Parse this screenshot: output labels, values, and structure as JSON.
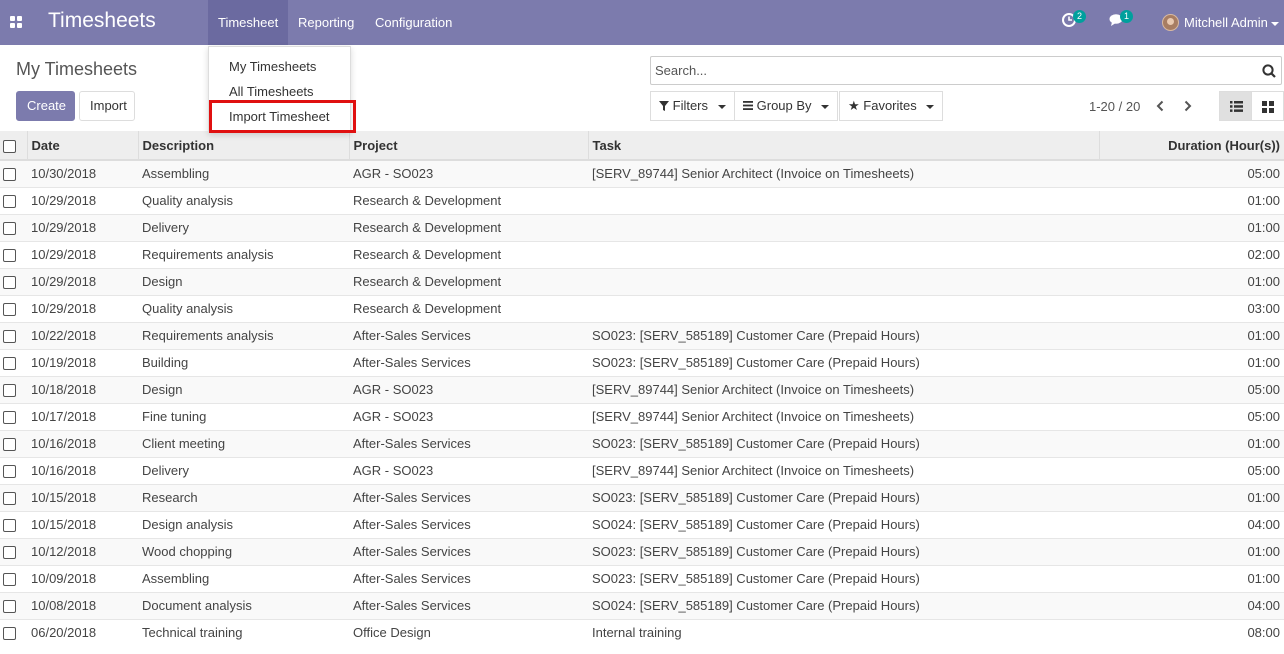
{
  "navbar": {
    "app_title": "Timesheets",
    "menu": [
      "Timesheet",
      "Reporting",
      "Configuration"
    ],
    "activity_badge": "2",
    "messages_badge": "1",
    "user_name": "Mitchell Admin"
  },
  "dropdown": {
    "items": [
      "My Timesheets",
      "All Timesheets",
      "Import Timesheet"
    ],
    "highlighted": "Import Timesheet"
  },
  "control_panel": {
    "title": "My Timesheets",
    "create_label": "Create",
    "import_label": "Import",
    "search_placeholder": "Search...",
    "filters_label": "Filters",
    "group_by_label": "Group By",
    "favorites_label": "Favorites",
    "pager": "1-20 / 20"
  },
  "table": {
    "columns": [
      "Date",
      "Description",
      "Project",
      "Task",
      "Duration (Hour(s))"
    ],
    "rows": [
      [
        "10/30/2018",
        "Assembling",
        "AGR - SO023",
        "[SERV_89744] Senior Architect (Invoice on Timesheets)",
        "05:00"
      ],
      [
        "10/29/2018",
        "Quality analysis",
        "Research & Development",
        "",
        "01:00"
      ],
      [
        "10/29/2018",
        "Delivery",
        "Research & Development",
        "",
        "01:00"
      ],
      [
        "10/29/2018",
        "Requirements analysis",
        "Research & Development",
        "",
        "02:00"
      ],
      [
        "10/29/2018",
        "Design",
        "Research & Development",
        "",
        "01:00"
      ],
      [
        "10/29/2018",
        "Quality analysis",
        "Research & Development",
        "",
        "03:00"
      ],
      [
        "10/22/2018",
        "Requirements analysis",
        "After-Sales Services",
        "SO023: [SERV_585189] Customer Care (Prepaid Hours)",
        "01:00"
      ],
      [
        "10/19/2018",
        "Building",
        "After-Sales Services",
        "SO023: [SERV_585189] Customer Care (Prepaid Hours)",
        "01:00"
      ],
      [
        "10/18/2018",
        "Design",
        "AGR - SO023",
        "[SERV_89744] Senior Architect (Invoice on Timesheets)",
        "05:00"
      ],
      [
        "10/17/2018",
        "Fine tuning",
        "AGR - SO023",
        "[SERV_89744] Senior Architect (Invoice on Timesheets)",
        "05:00"
      ],
      [
        "10/16/2018",
        "Client meeting",
        "After-Sales Services",
        "SO023: [SERV_585189] Customer Care (Prepaid Hours)",
        "01:00"
      ],
      [
        "10/16/2018",
        "Delivery",
        "AGR - SO023",
        "[SERV_89744] Senior Architect (Invoice on Timesheets)",
        "05:00"
      ],
      [
        "10/15/2018",
        "Research",
        "After-Sales Services",
        "SO023: [SERV_585189] Customer Care (Prepaid Hours)",
        "01:00"
      ],
      [
        "10/15/2018",
        "Design analysis",
        "After-Sales Services",
        "SO024: [SERV_585189] Customer Care (Prepaid Hours)",
        "04:00"
      ],
      [
        "10/12/2018",
        "Wood chopping",
        "After-Sales Services",
        "SO023: [SERV_585189] Customer Care (Prepaid Hours)",
        "01:00"
      ],
      [
        "10/09/2018",
        "Assembling",
        "After-Sales Services",
        "SO023: [SERV_585189] Customer Care (Prepaid Hours)",
        "01:00"
      ],
      [
        "10/08/2018",
        "Document analysis",
        "After-Sales Services",
        "SO024: [SERV_585189] Customer Care (Prepaid Hours)",
        "04:00"
      ],
      [
        "06/20/2018",
        "Technical training",
        "Office Design",
        "Internal training",
        "08:00"
      ]
    ]
  },
  "colors": {
    "navbar": "#7c7bad",
    "highlight_box": "#e01010",
    "badge": "#00a09d"
  }
}
